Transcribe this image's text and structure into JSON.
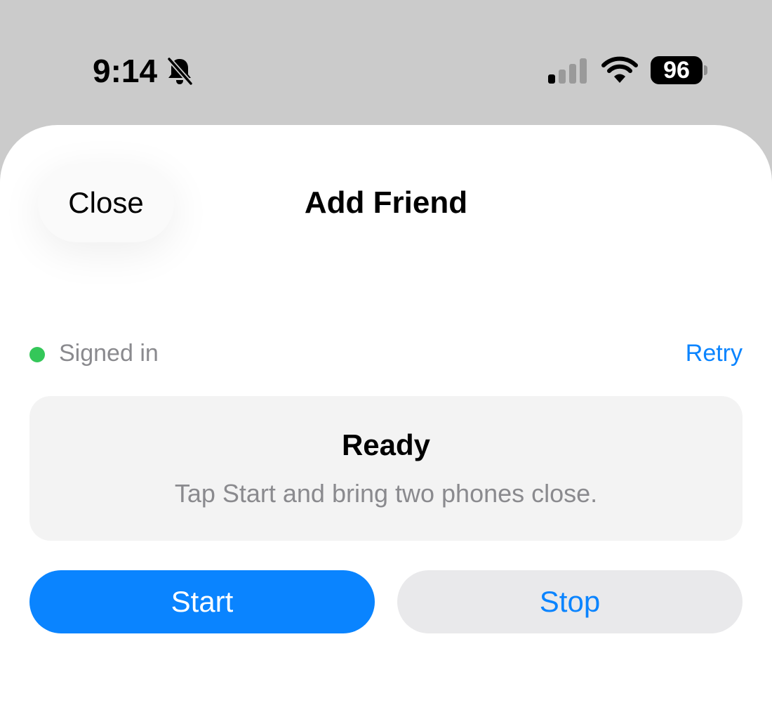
{
  "status_bar": {
    "time": "9:14",
    "battery_level": "96",
    "icons": [
      "bell-slash-icon",
      "cellular-signal-icon",
      "wifi-icon",
      "battery-icon"
    ]
  },
  "sheet": {
    "close_label": "Close",
    "title": "Add Friend",
    "connection_status": "Signed in",
    "retry_label": "Retry",
    "card": {
      "title": "Ready",
      "subtitle": "Tap Start and bring two phones close."
    },
    "start_label": "Start",
    "stop_label": "Stop"
  },
  "colors": {
    "accent": "#0a84ff",
    "status_ok": "#34c759",
    "backdrop": "#cbcbcb"
  }
}
